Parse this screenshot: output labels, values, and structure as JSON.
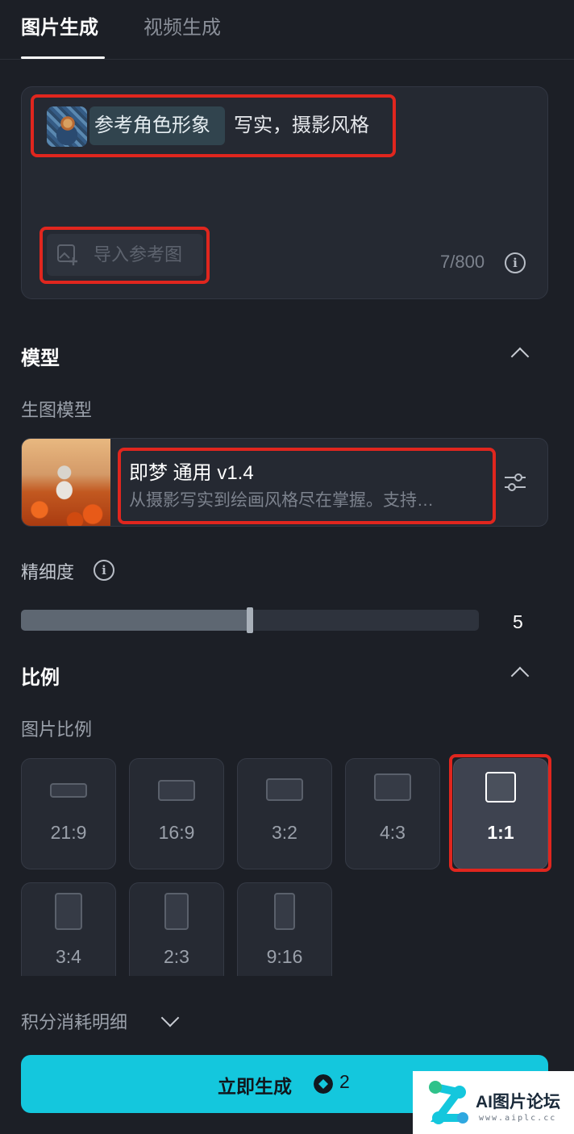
{
  "tabs": {
    "image_gen": "图片生成",
    "video_gen": "视频生成"
  },
  "prompt": {
    "ref_chip_label": "参考角色形象",
    "text": "写实，摄影风格",
    "import_button": "导入参考图",
    "char_count": "7/800"
  },
  "model_section": {
    "title": "模型",
    "subtitle": "生图模型",
    "model_name": "即梦 通用 v1.4",
    "model_desc": "从摄影写实到绘画风格尽在掌握。支持…",
    "detail_label": "精细度",
    "detail_value": "5",
    "detail_fill_fraction": 0.5
  },
  "ratio_section": {
    "title": "比例",
    "subtitle": "图片比例",
    "options": [
      "21:9",
      "16:9",
      "3:2",
      "4:3",
      "1:1",
      "3:4",
      "2:3",
      "9:16"
    ],
    "selected": "1:1"
  },
  "footer": {
    "credit_detail": "积分消耗明细",
    "generate_label": "立即生成",
    "generate_cost": "2"
  },
  "watermark": {
    "name": "AI图片论坛",
    "url": "www.aiplc.cc"
  },
  "colors": {
    "accent": "#14c7dd",
    "highlight_red": "#e0261e",
    "background": "#1c1f26"
  },
  "icons": [
    "info-icon",
    "chevron-up-icon",
    "chevron-down-icon",
    "settings-sliders-icon",
    "image-add-icon",
    "credit-icon"
  ]
}
